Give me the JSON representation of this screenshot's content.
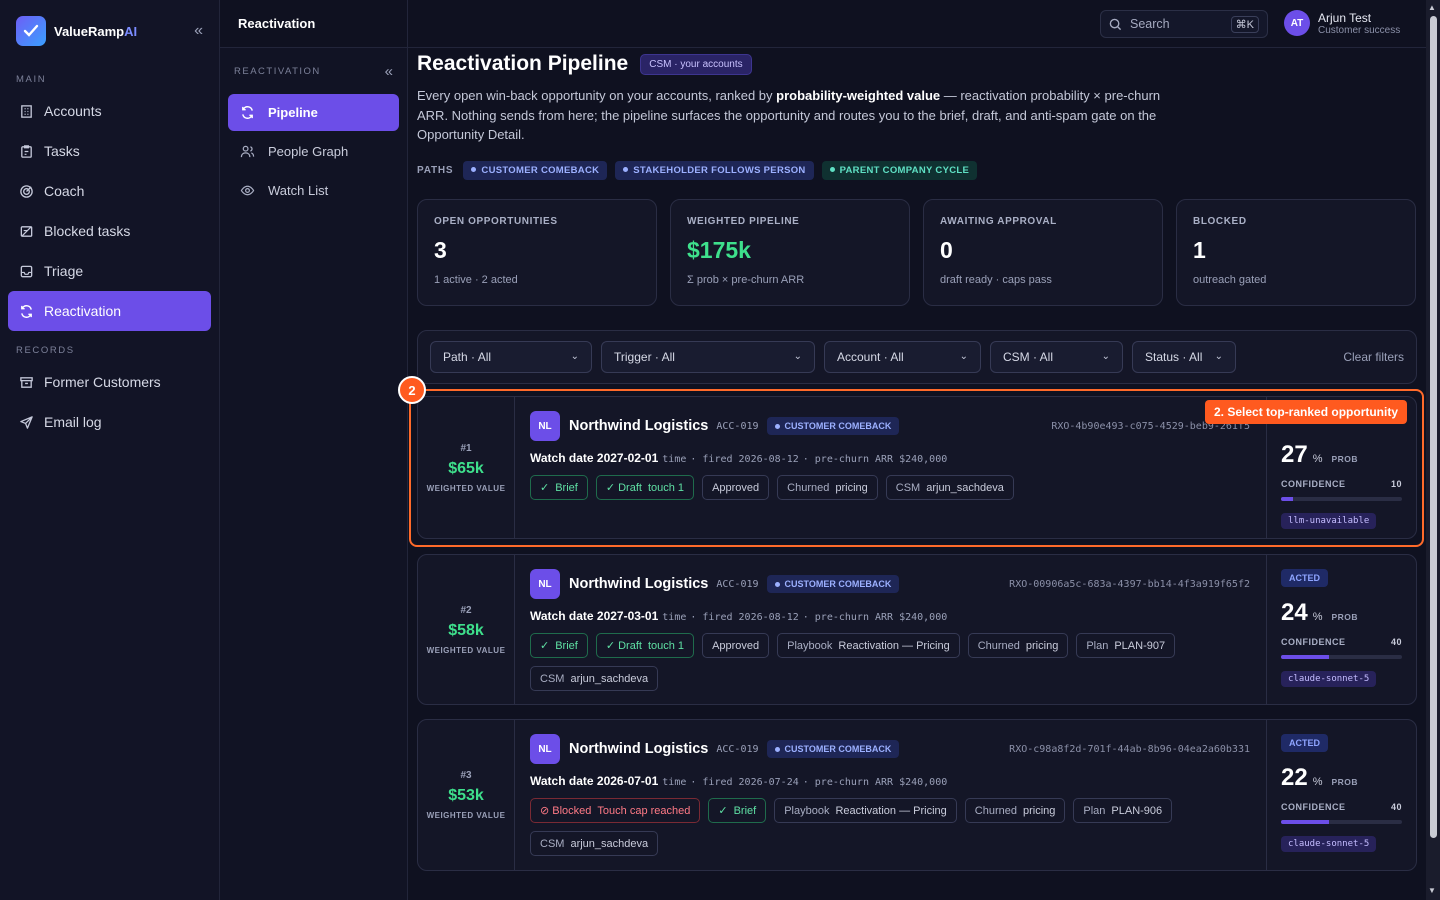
{
  "brand": {
    "name_main": "ValueRamp",
    "name_accent": "AI"
  },
  "sidebar": {
    "section_main": "MAIN",
    "section_records": "RECORDS",
    "main_items": [
      {
        "label": "Accounts",
        "icon": "building-icon"
      },
      {
        "label": "Tasks",
        "icon": "clipboard-icon"
      },
      {
        "label": "Coach",
        "icon": "target-icon"
      },
      {
        "label": "Blocked tasks",
        "icon": "blocked-icon"
      },
      {
        "label": "Triage",
        "icon": "inbox-icon"
      },
      {
        "label": "Reactivation",
        "icon": "refresh-icon",
        "active": true
      }
    ],
    "record_items": [
      {
        "label": "Former Customers",
        "icon": "archive-icon"
      },
      {
        "label": "Email log",
        "icon": "send-icon"
      }
    ]
  },
  "subnav": {
    "header_title": "Reactivation",
    "section": "REACTIVATION",
    "items": [
      {
        "label": "Pipeline",
        "icon": "refresh-icon",
        "active": true
      },
      {
        "label": "People Graph",
        "icon": "people-icon"
      },
      {
        "label": "Watch List",
        "icon": "eye-icon"
      }
    ]
  },
  "topbar": {
    "search_placeholder": "Search",
    "search_shortcut": "⌘K",
    "user_initials": "AT",
    "user_name": "Arjun Test",
    "user_role": "Customer success"
  },
  "page": {
    "title": "Reactivation Pipeline",
    "scope_badge": "CSM · your accounts",
    "desc_1": "Every open win-back opportunity on your accounts, ranked by ",
    "desc_bold": "probability-weighted value",
    "desc_2": " — reactivation probability × pre-churn ARR. Nothing sends from here; the pipeline surfaces the opportunity and routes you to the brief, draft, and anti-spam gate on the Opportunity Detail.",
    "paths_label": "PATHS",
    "paths": [
      "CUSTOMER COMEBACK",
      "STAKEHOLDER FOLLOWS PERSON",
      "PARENT COMPANY CYCLE"
    ]
  },
  "stats": [
    {
      "label": "OPEN OPPORTUNITIES",
      "value": "3",
      "sub": "1 active · 2 acted"
    },
    {
      "label": "WEIGHTED PIPELINE",
      "value": "$175k",
      "sub": "Σ prob × pre-churn ARR"
    },
    {
      "label": "AWAITING APPROVAL",
      "value": "0",
      "sub": "draft ready · caps pass"
    },
    {
      "label": "BLOCKED",
      "value": "1",
      "sub": "outreach gated"
    }
  ],
  "filters": {
    "path": "Path · All",
    "trigger": "Trigger · All",
    "account": "Account · All",
    "csm": "CSM · All",
    "status": "Status · All",
    "clear": "Clear filters"
  },
  "opportunities": [
    {
      "rank": "#1",
      "weighted": "$65k",
      "weighted_label": "WEIGHTED VALUE",
      "initials": "NL",
      "account": "Northwind Logistics",
      "acc_id": "ACC-019",
      "path": "CUSTOMER COMEBACK",
      "rxo": "RXO-4b90e493-c075-4529-beb9-261f5",
      "watch": "Watch date 2027-02-01",
      "time": "time",
      "fired": "· fired 2026-08-12",
      "arr": "· pre-churn ARR $240,000",
      "tags": [
        {
          "k": "✓",
          "v": "Brief",
          "type": "ok"
        },
        {
          "k": "✓ Draft",
          "v": "touch 1",
          "type": "ok"
        },
        {
          "k": "",
          "v": "Approved",
          "type": ""
        },
        {
          "k": "Churned",
          "v": "pricing",
          "type": ""
        },
        {
          "k": "CSM",
          "v": "arjun_sachdeva",
          "type": ""
        }
      ],
      "status": "",
      "prob": "27",
      "pct": "%",
      "prob_label": "PROB",
      "conf_label": "CONFIDENCE",
      "confidence": 10,
      "confidence_text": "10",
      "model": "llm-unavailable"
    },
    {
      "rank": "#2",
      "weighted": "$58k",
      "weighted_label": "WEIGHTED VALUE",
      "initials": "NL",
      "account": "Northwind Logistics",
      "acc_id": "ACC-019",
      "path": "CUSTOMER COMEBACK",
      "rxo": "RXO-00906a5c-683a-4397-bb14-4f3a919f65f2",
      "watch": "Watch date 2027-03-01",
      "time": "time",
      "fired": "· fired 2026-08-12",
      "arr": "· pre-churn ARR $240,000",
      "tags": [
        {
          "k": "✓",
          "v": "Brief",
          "type": "ok"
        },
        {
          "k": "✓ Draft",
          "v": "touch 1",
          "type": "ok"
        },
        {
          "k": "",
          "v": "Approved",
          "type": ""
        },
        {
          "k": "Playbook",
          "v": "Reactivation — Pricing",
          "type": ""
        },
        {
          "k": "Churned",
          "v": "pricing",
          "type": ""
        },
        {
          "k": "Plan",
          "v": "PLAN-907",
          "type": ""
        },
        {
          "k": "CSM",
          "v": "arjun_sachdeva",
          "type": ""
        }
      ],
      "status": "ACTED",
      "prob": "24",
      "pct": "%",
      "prob_label": "PROB",
      "conf_label": "CONFIDENCE",
      "confidence": 40,
      "confidence_text": "40",
      "model": "claude-sonnet-5"
    },
    {
      "rank": "#3",
      "weighted": "$53k",
      "weighted_label": "WEIGHTED VALUE",
      "initials": "NL",
      "account": "Northwind Logistics",
      "acc_id": "ACC-019",
      "path": "CUSTOMER COMEBACK",
      "rxo": "RXO-c98a8f2d-701f-44ab-8b96-04ea2a60b331",
      "watch": "Watch date 2026-07-01",
      "time": "time",
      "fired": "· fired 2026-07-24",
      "arr": "· pre-churn ARR $240,000",
      "tags": [
        {
          "k": "⊘ Blocked",
          "v": "Touch cap reached",
          "type": "bad"
        },
        {
          "k": "✓",
          "v": "Brief",
          "type": "ok"
        },
        {
          "k": "Playbook",
          "v": "Reactivation — Pricing",
          "type": ""
        },
        {
          "k": "Churned",
          "v": "pricing",
          "type": ""
        },
        {
          "k": "Plan",
          "v": "PLAN-906",
          "type": ""
        },
        {
          "k": "CSM",
          "v": "arjun_sachdeva",
          "type": ""
        }
      ],
      "status": "ACTED",
      "prob": "22",
      "pct": "%",
      "prob_label": "PROB",
      "conf_label": "CONFIDENCE",
      "confidence": 40,
      "confidence_text": "40",
      "model": "claude-sonnet-5"
    }
  ],
  "annotation": {
    "step": "2",
    "label": "2. Select top-ranked opportunity"
  }
}
